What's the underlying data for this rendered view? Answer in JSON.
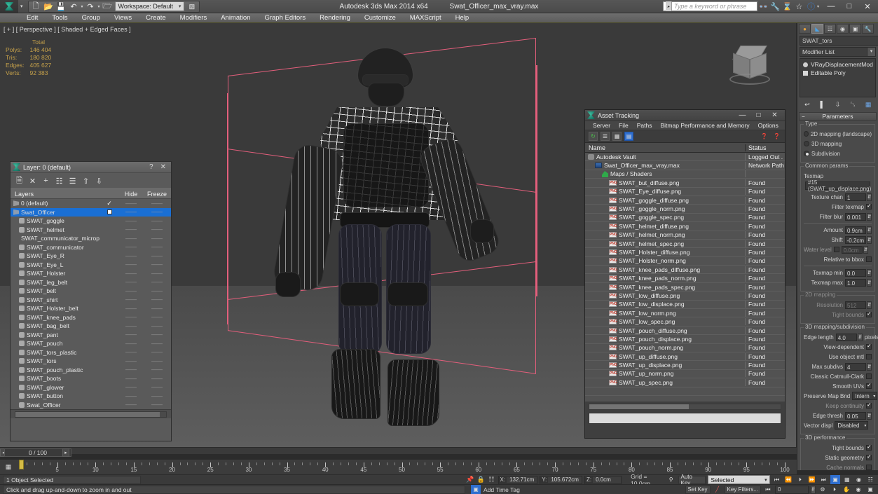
{
  "titlebar": {
    "app_title": "Autodesk 3ds Max  2014 x64",
    "file_title": "Swat_Officer_max_vray.max",
    "workspace": "Workspace: Default",
    "search_placeholder": "Type a keyword or phrase",
    "quick_icons": [
      "new-icon",
      "open-icon",
      "save-icon",
      "undo-icon",
      "redo-icon",
      "set-project-icon"
    ],
    "right_icons": [
      "binoculars-icon",
      "wrench-icon",
      "hourglass-icon",
      "star-icon",
      "help-icon"
    ],
    "window_buttons": [
      "minimize",
      "maximize",
      "close"
    ]
  },
  "menubar": {
    "items": [
      "Edit",
      "Tools",
      "Group",
      "Views",
      "Create",
      "Modifiers",
      "Animation",
      "Graph Editors",
      "Rendering",
      "Customize",
      "MAXScript",
      "Help"
    ]
  },
  "viewport": {
    "label": "[ + ] [ Perspective ] [ Shaded + Edged Faces ]",
    "stats_header": "Total",
    "stats": [
      {
        "label": "Polys:",
        "value": "146 404"
      },
      {
        "label": "Tris:",
        "value": "180 820"
      },
      {
        "label": "Edges:",
        "value": "405 627"
      },
      {
        "label": "Verts:",
        "value": "92 383"
      }
    ],
    "stats_color": "#c6a14a",
    "gizmo_color": "#e45f7c"
  },
  "layer_dialog": {
    "title": "Layer: 0 (default)",
    "help_glyph": "?",
    "close_glyph": "✕",
    "toolbar_icons": [
      "new-layer-icon",
      "delete-layer-icon",
      "add-layer-icon",
      "select-layer-icon",
      "highlight-layer-icon",
      "add-selection-icon",
      "select-objects-icon"
    ],
    "columns": {
      "name": "Layers",
      "hide": "Hide",
      "freeze": "Freeze"
    },
    "rows": [
      {
        "name": "0 (default)",
        "indent": 0,
        "selected": false,
        "check": "✓",
        "hide": "——",
        "freeze": "——"
      },
      {
        "name": "Swat_Officer",
        "indent": 0,
        "selected": true,
        "check": "box",
        "hide": "——",
        "freeze": "——"
      },
      {
        "name": "SWAT_goggle",
        "indent": 1,
        "selected": false,
        "check": "",
        "hide": "——",
        "freeze": "——"
      },
      {
        "name": "SWAT_helmet",
        "indent": 1,
        "selected": false,
        "check": "",
        "hide": "——",
        "freeze": "——"
      },
      {
        "name": "SWAT_communicator_microphone",
        "indent": 1,
        "selected": false,
        "check": "",
        "hide": "——",
        "freeze": "——"
      },
      {
        "name": "SWAT_communicator",
        "indent": 1,
        "selected": false,
        "check": "",
        "hide": "——",
        "freeze": "——"
      },
      {
        "name": "SWAT_Eye_R",
        "indent": 1,
        "selected": false,
        "check": "",
        "hide": "——",
        "freeze": "——"
      },
      {
        "name": "SWAT_Eye_L",
        "indent": 1,
        "selected": false,
        "check": "",
        "hide": "——",
        "freeze": "——"
      },
      {
        "name": "SWAT_Holster",
        "indent": 1,
        "selected": false,
        "check": "",
        "hide": "——",
        "freeze": "——"
      },
      {
        "name": "SWAT_leg_belt",
        "indent": 1,
        "selected": false,
        "check": "",
        "hide": "——",
        "freeze": "——"
      },
      {
        "name": "SWAT_belt",
        "indent": 1,
        "selected": false,
        "check": "",
        "hide": "——",
        "freeze": "——"
      },
      {
        "name": "SWAT_shirt",
        "indent": 1,
        "selected": false,
        "check": "",
        "hide": "——",
        "freeze": "——"
      },
      {
        "name": "SWAT_Holster_belt",
        "indent": 1,
        "selected": false,
        "check": "",
        "hide": "——",
        "freeze": "——"
      },
      {
        "name": "SWAT_knee_pads",
        "indent": 1,
        "selected": false,
        "check": "",
        "hide": "——",
        "freeze": "——"
      },
      {
        "name": "SWAT_bag_belt",
        "indent": 1,
        "selected": false,
        "check": "",
        "hide": "——",
        "freeze": "——"
      },
      {
        "name": "SWAT_pant",
        "indent": 1,
        "selected": false,
        "check": "",
        "hide": "——",
        "freeze": "——"
      },
      {
        "name": "SWAT_pouch",
        "indent": 1,
        "selected": false,
        "check": "",
        "hide": "——",
        "freeze": "——"
      },
      {
        "name": "SWAT_tors_plastic",
        "indent": 1,
        "selected": false,
        "check": "",
        "hide": "——",
        "freeze": "——"
      },
      {
        "name": "SWAT_tors",
        "indent": 1,
        "selected": false,
        "check": "",
        "hide": "——",
        "freeze": "——"
      },
      {
        "name": "SWAT_pouch_plastic",
        "indent": 1,
        "selected": false,
        "check": "",
        "hide": "——",
        "freeze": "——"
      },
      {
        "name": "SWAT_boots",
        "indent": 1,
        "selected": false,
        "check": "",
        "hide": "——",
        "freeze": "——"
      },
      {
        "name": "SWAT_glower",
        "indent": 1,
        "selected": false,
        "check": "",
        "hide": "——",
        "freeze": "——"
      },
      {
        "name": "SWAT_button",
        "indent": 1,
        "selected": false,
        "check": "",
        "hide": "——",
        "freeze": "——"
      },
      {
        "name": "Swat_Officer",
        "indent": 1,
        "selected": false,
        "check": "",
        "hide": "——",
        "freeze": "——"
      }
    ],
    "selected_color": "#1a6fd4"
  },
  "asset_tracking": {
    "title": "Asset Tracking",
    "menu": [
      "Server",
      "File",
      "Paths",
      "Bitmap Performance and Memory",
      "Options"
    ],
    "toolbar_icons": [
      "refresh-icon",
      "list-icon",
      "thumbnail-icon",
      "table-icon"
    ],
    "toolbar_right_icons": [
      "help-icon",
      "about-icon"
    ],
    "columns": {
      "name": "Name",
      "status": "Status"
    },
    "rows": [
      {
        "name": "Autodesk Vault",
        "status": "Logged Out .",
        "icon": "vault-icon",
        "indent": 0
      },
      {
        "name": "Swat_Officer_max_vray.max",
        "status": "Network Path",
        "icon": "max-file-icon",
        "indent": 1
      },
      {
        "name": "Maps / Shaders",
        "status": "",
        "icon": "maps-icon",
        "indent": 2
      },
      {
        "name": "SWAT_but_diffuse.png",
        "status": "Found",
        "icon": "png-icon",
        "indent": 3
      },
      {
        "name": "SWAT_Eye_diffuse.png",
        "status": "Found",
        "icon": "png-icon",
        "indent": 3
      },
      {
        "name": "SWAT_goggle_diffuse.png",
        "status": "Found",
        "icon": "png-icon",
        "indent": 3
      },
      {
        "name": "SWAT_goggle_norm.png",
        "status": "Found",
        "icon": "png-icon",
        "indent": 3
      },
      {
        "name": "SWAT_goggle_spec.png",
        "status": "Found",
        "icon": "png-icon",
        "indent": 3
      },
      {
        "name": "SWAT_helmet_diffuse.png",
        "status": "Found",
        "icon": "png-icon",
        "indent": 3
      },
      {
        "name": "SWAT_helmet_norm.png",
        "status": "Found",
        "icon": "png-icon",
        "indent": 3
      },
      {
        "name": "SWAT_helmet_spec.png",
        "status": "Found",
        "icon": "png-icon",
        "indent": 3
      },
      {
        "name": "SWAT_Holster_diffuse.png",
        "status": "Found",
        "icon": "png-icon",
        "indent": 3
      },
      {
        "name": "SWAT_Holster_norm.png",
        "status": "Found",
        "icon": "png-icon",
        "indent": 3
      },
      {
        "name": "SWAT_knee_pads_diffuse.png",
        "status": "Found",
        "icon": "png-icon",
        "indent": 3
      },
      {
        "name": "SWAT_knee_pads_norm.png",
        "status": "Found",
        "icon": "png-icon",
        "indent": 3
      },
      {
        "name": "SWAT_knee_pads_spec.png",
        "status": "Found",
        "icon": "png-icon",
        "indent": 3
      },
      {
        "name": "SWAT_low_diffuse.png",
        "status": "Found",
        "icon": "png-icon",
        "indent": 3
      },
      {
        "name": "SWAT_low_displace.png",
        "status": "Found",
        "icon": "png-icon",
        "indent": 3
      },
      {
        "name": "SWAT_low_norm.png",
        "status": "Found",
        "icon": "png-icon",
        "indent": 3
      },
      {
        "name": "SWAT_low_spec.png",
        "status": "Found",
        "icon": "png-icon",
        "indent": 3
      },
      {
        "name": "SWAT_pouch_diffuse.png",
        "status": "Found",
        "icon": "png-icon",
        "indent": 3
      },
      {
        "name": "SWAT_pouch_displace.png",
        "status": "Found",
        "icon": "png-icon",
        "indent": 3
      },
      {
        "name": "SWAT_pouch_norm.png",
        "status": "Found",
        "icon": "png-icon",
        "indent": 3
      },
      {
        "name": "SWAT_up_diffuse.png",
        "status": "Found",
        "icon": "png-icon",
        "indent": 3
      },
      {
        "name": "SWAT_up_displace.png",
        "status": "Found",
        "icon": "png-icon",
        "indent": 3
      },
      {
        "name": "SWAT_up_norm.png",
        "status": "Found",
        "icon": "png-icon",
        "indent": 3
      },
      {
        "name": "SWAT_up_spec.png",
        "status": "Found",
        "icon": "png-icon",
        "indent": 3
      }
    ]
  },
  "command_panel": {
    "tabs": [
      "create-tab",
      "modify-tab",
      "hierarchy-tab",
      "motion-tab",
      "display-tab",
      "utilities-tab"
    ],
    "active_tab_index": 1,
    "object_name": "SWAT_tors",
    "modifier_list_label": "Modifier List",
    "stack": [
      {
        "label": "VRayDisplacementMod",
        "icon": "bulb-icon"
      },
      {
        "label": "Editable Poly",
        "icon": "square-icon"
      }
    ],
    "stack_buttons": [
      "pin-stack-icon",
      "show-end-result-icon",
      "make-unique-icon",
      "remove-modifier-icon",
      "configure-sets-icon"
    ],
    "rollout_parameters": "Parameters",
    "type_group": {
      "caption": "Type",
      "options": [
        {
          "label": "2D mapping (landscape)",
          "selected": false
        },
        {
          "label": "3D mapping",
          "selected": false
        },
        {
          "label": "Subdivision",
          "selected": true
        }
      ]
    },
    "common_params": {
      "caption": "Common params",
      "texmap_label": "Texmap",
      "texmap_value": "#15 (SWAT_up_displace.png)",
      "texture_chan_label": "Texture chan",
      "texture_chan_value": "1",
      "filter_texmap_label": "Filter texmap",
      "filter_texmap_checked": true,
      "filter_blur_label": "Filter blur",
      "filter_blur_value": "0.001",
      "amount_label": "Amount",
      "amount_value": "0.9cm",
      "shift_label": "Shift",
      "shift_value": "-0.2cm",
      "water_level_label": "Water level",
      "water_level_value": "0.0cm",
      "water_level_checked": false,
      "relative_to_bbox_label": "Relative to bbox",
      "relative_to_bbox_checked": false,
      "texmap_min_label": "Texmap min",
      "texmap_min_value": "0.0",
      "texmap_max_label": "Texmap max",
      "texmap_max_value": "1.0"
    },
    "mapping_2d": {
      "caption": "2D mapping",
      "resolution_label": "Resolution",
      "resolution_value": "512",
      "tight_bounds_label": "Tight bounds",
      "tight_bounds_checked": true
    },
    "mapping_3d": {
      "caption": "3D mapping/subdivision",
      "edge_length_label": "Edge length",
      "edge_length_value": "4.0",
      "edge_length_unit": "pixels",
      "view_dependent_label": "View-dependent",
      "view_dependent_checked": true,
      "use_object_mtl_label": "Use object mtl",
      "use_object_mtl_checked": false,
      "max_subdivs_label": "Max subdivs",
      "max_subdivs_value": "4",
      "classic_catmull_clark_label": "Classic Catmull-Clark",
      "classic_catmull_clark_checked": false,
      "smooth_uvs_label": "Smooth UVs",
      "smooth_uvs_checked": true,
      "preserve_map_bnd_label": "Preserve Map Bnd",
      "preserve_map_bnd_value": "Intern",
      "keep_continuity_label": "Keep continuity",
      "keep_continuity_checked": true,
      "edge_thresh_label": "Edge thresh",
      "edge_thresh_value": "0.05",
      "vector_displ_label": "Vector displ",
      "vector_displ_value": "Disabled"
    },
    "performance_3d": {
      "caption": "3D performance",
      "tight_bounds_label": "Tight bounds",
      "tight_bounds_checked": true,
      "static_geometry_label": "Static geometry",
      "static_geometry_checked": true,
      "cache_normals_label": "Cache normals",
      "cache_normals_checked": false
    }
  },
  "timeline": {
    "frame_display": "0 / 100",
    "prev_glyph": "◂",
    "next_glyph": "▸",
    "ruler_labels": [
      "5",
      "10",
      "15",
      "20",
      "25",
      "30",
      "35",
      "40",
      "45",
      "50",
      "55",
      "60",
      "65",
      "70",
      "75",
      "80",
      "85",
      "90",
      "95",
      "100"
    ]
  },
  "statusbar": {
    "selection_status": "1 Object Selected",
    "prompt": "Click and drag up-and-down to zoom in and out",
    "coords": [
      {
        "axis": "X:",
        "value": "132.71cm"
      },
      {
        "axis": "Y:",
        "value": "105.672cm"
      },
      {
        "axis": "Z:",
        "value": "0.0cm"
      }
    ],
    "grid_label": "Grid = 10.0cm",
    "add_time_tag": "Add Time Tag",
    "auto_key": "Auto Key",
    "set_key": "Set Key",
    "key_filters": "Key Filters...",
    "selection_mode": "Selected",
    "key_frame_value": "0",
    "lock_icon": "lock-icon",
    "pin_icon": "pin-icon",
    "absolute_icon": "absolute-mode-icon"
  }
}
